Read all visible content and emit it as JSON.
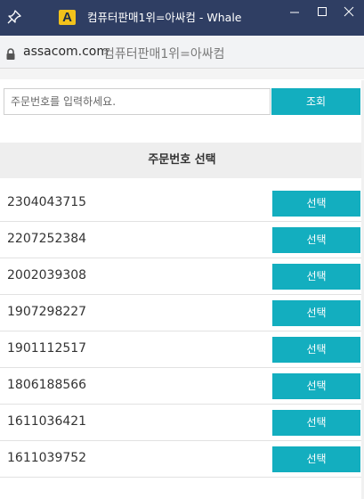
{
  "window": {
    "title": "컴퓨터판매1위=아싸컴 - Whale",
    "app_icon_letter": "A",
    "app_icon_color": "#f2c21b",
    "titlebar_color": "#2f3e63"
  },
  "address_bar": {
    "domain": "assacom.com",
    "page_title": "컴퓨터판매1위=아싸컴"
  },
  "search": {
    "placeholder": "주문번호를 입력하세요.",
    "value": "",
    "button_label": "조회"
  },
  "section": {
    "title": "주문번호 선택"
  },
  "orders": {
    "select_label": "선택",
    "items": [
      {
        "number": "2304043715"
      },
      {
        "number": "2207252384"
      },
      {
        "number": "2002039308"
      },
      {
        "number": "1907298227"
      },
      {
        "number": "1901112517"
      },
      {
        "number": "1806188566"
      },
      {
        "number": "1611036421"
      },
      {
        "number": "1611039752"
      }
    ]
  },
  "accent_color": "#13aebf"
}
